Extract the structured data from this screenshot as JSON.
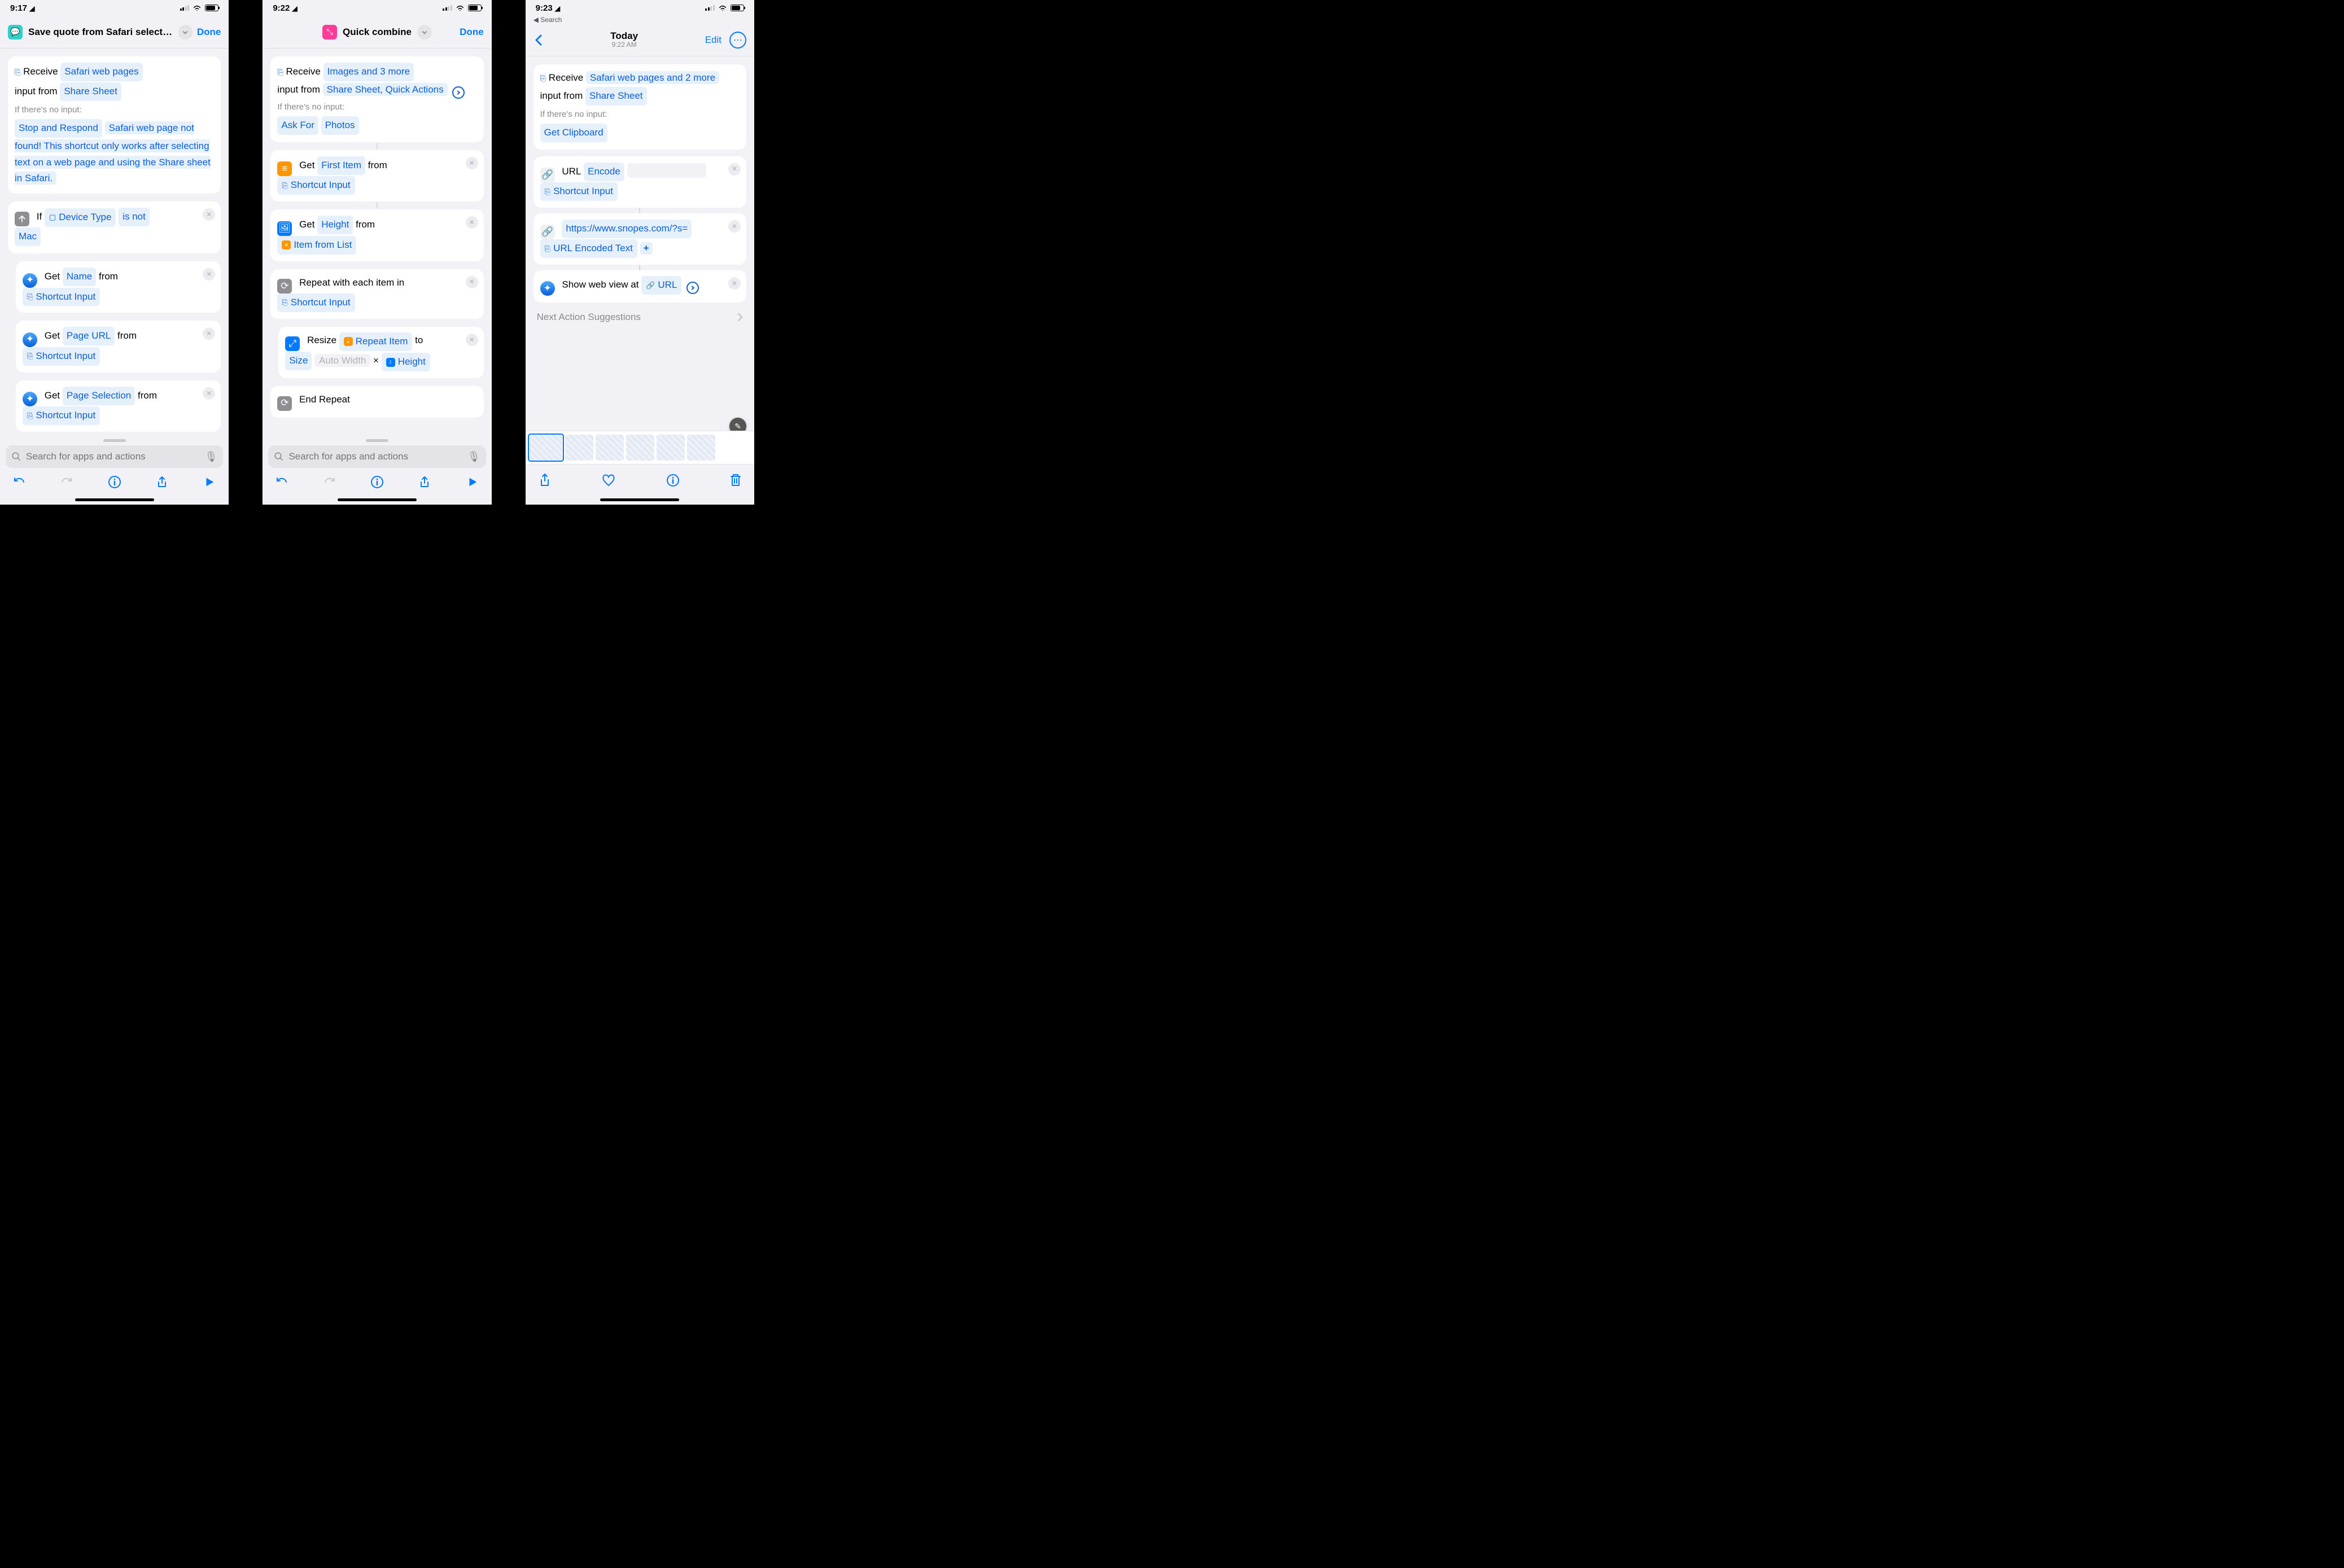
{
  "p1": {
    "time": "9:17",
    "title": "Save quote from Safari selection",
    "done": "Done",
    "receive": {
      "verb": "Receive",
      "type": "Safari web pages",
      "from_text": "input from",
      "source": "Share Sheet",
      "noinput_label": "If there's no input:",
      "stop_label": "Stop and Respond",
      "stop_text": "Safari web page not found! This shortcut only works after selecting text on a web page and using the Share sheet in Safari."
    },
    "ifcard": {
      "if": "If",
      "var": "Device Type",
      "op": "is not",
      "val": "Mac"
    },
    "get1": {
      "get": "Get",
      "what": "Name",
      "from": "from",
      "src": "Shortcut Input"
    },
    "get2": {
      "get": "Get",
      "what": "Page URL",
      "from": "from",
      "src": "Shortcut Input"
    },
    "get3": {
      "get": "Get",
      "what": "Page Selection",
      "from": "from",
      "src": "Shortcut Input"
    },
    "search_ph": "Search for apps and actions"
  },
  "p2": {
    "time": "9:22",
    "title": "Quick combine",
    "done": "Done",
    "receive": {
      "verb": "Receive",
      "type": "Images and 3 more",
      "from_text": "input from",
      "source": "Share Sheet, Quick Actions",
      "noinput_label": "If there's no input:",
      "ask": "Ask For",
      "photos": "Photos"
    },
    "get1": {
      "get": "Get",
      "what": "First Item",
      "from": "from",
      "src": "Shortcut Input"
    },
    "get2": {
      "get": "Get",
      "what": "Height",
      "from": "from",
      "src": "Item from List"
    },
    "repeat": {
      "text": "Repeat with each item in",
      "src": "Shortcut Input"
    },
    "resize": {
      "verb": "Resize",
      "item": "Repeat Item",
      "to": "to",
      "size": "Size",
      "auto": "Auto Width",
      "x": "×",
      "height": "Height"
    },
    "end": "End Repeat",
    "search_ph": "Search for apps and actions"
  },
  "p3": {
    "time": "9:23",
    "back": "Search",
    "title": "Today",
    "subtitle": "9:22 AM",
    "edit": "Edit",
    "receive": {
      "verb": "Receive",
      "type": "Safari web pages and 2 more",
      "from_text": "input from",
      "source": "Share Sheet",
      "noinput_label": "If there's no input:",
      "getclip": "Get Clipboard"
    },
    "url1": {
      "verb": "URL",
      "enc": "Encode",
      "src": "Shortcut Input"
    },
    "url2": {
      "url": "https://www.snopes.com/?s=",
      "enc": "URL Encoded Text"
    },
    "show": {
      "text": "Show web view at",
      "url": "URL"
    },
    "suggest": "Next Action Suggestions"
  }
}
